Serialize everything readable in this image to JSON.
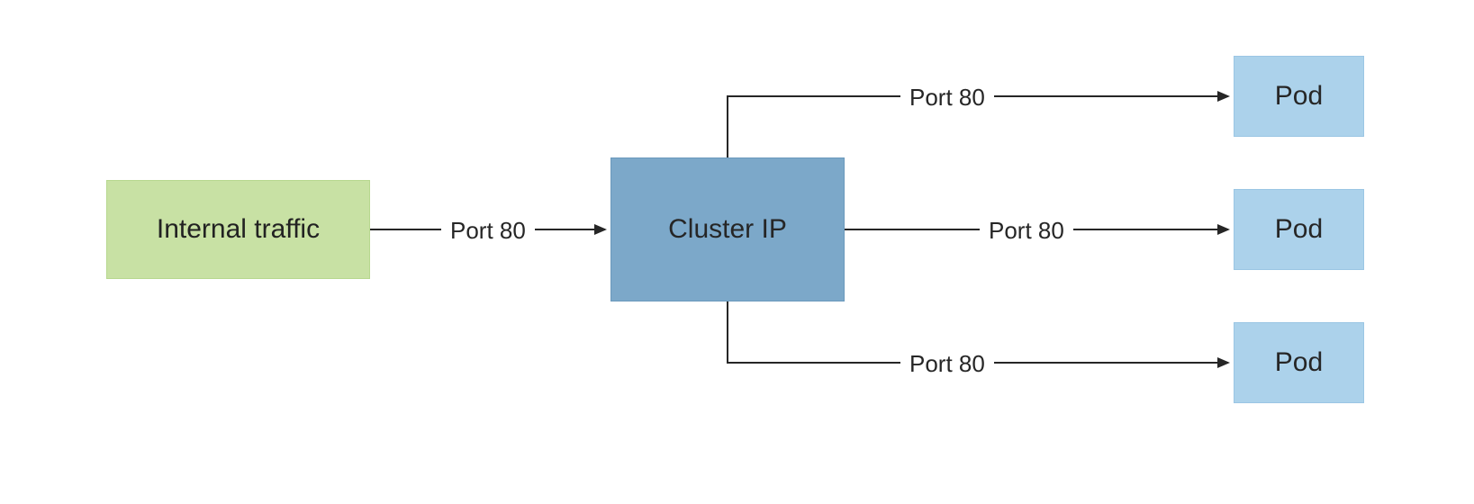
{
  "nodes": {
    "source": {
      "label": "Internal traffic"
    },
    "service": {
      "label": "Cluster IP"
    },
    "pod1": {
      "label": "Pod"
    },
    "pod2": {
      "label": "Pod"
    },
    "pod3": {
      "label": "Pod"
    }
  },
  "edges": {
    "in": {
      "label": "Port 80"
    },
    "out1": {
      "label": "Port 80"
    },
    "out2": {
      "label": "Port 80"
    },
    "out3": {
      "label": "Port 80"
    }
  },
  "colors": {
    "green": "#C8E1A4",
    "blue": "#7CA8C9",
    "lightblue": "#ACD2EB",
    "line": "#262626"
  }
}
